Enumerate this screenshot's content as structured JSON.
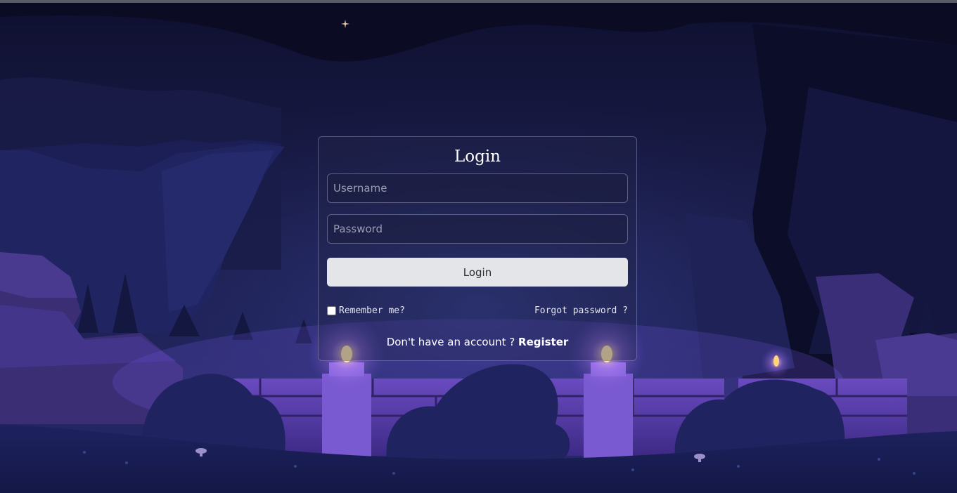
{
  "login": {
    "title": "Login",
    "username_placeholder": "Username",
    "password_placeholder": "Password",
    "login_button": "Login",
    "remember_label": "Remember me?",
    "forgot_label": "Forgot password ?",
    "no_account_text": "Don't have an account ?",
    "register_label": "Register"
  },
  "theme": {
    "sky": "#141536",
    "cliff": "#1f2150",
    "rock": "#3a2f72",
    "wall": "#5b3fa6",
    "bush": "#1c2058",
    "glow": "#ffd27a",
    "button_bg": "#e4e5e8"
  }
}
